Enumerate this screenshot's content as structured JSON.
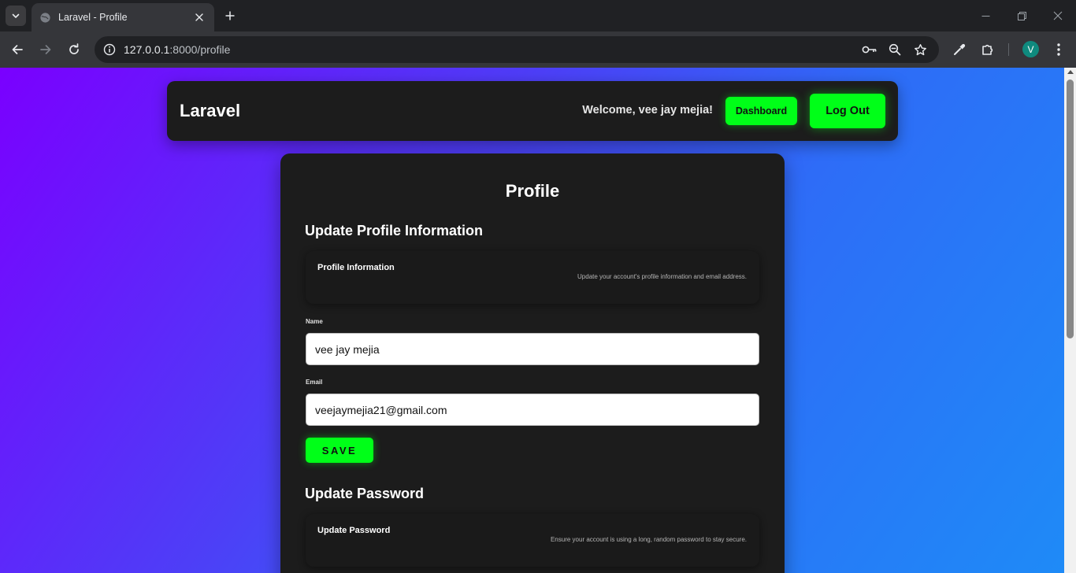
{
  "browser": {
    "tab_title": "Laravel - Profile",
    "url_host": "127.0.0.1",
    "url_path": ":8000/profile",
    "profile_initial": "V"
  },
  "nav": {
    "brand": "Laravel",
    "welcome": "Welcome, vee jay mejia!",
    "dashboard_label": "Dashboard",
    "logout_label": "Log Out"
  },
  "profile": {
    "page_title": "Profile",
    "update_info": {
      "section_title": "Update Profile Information",
      "box_title": "Profile Information",
      "box_description": "Update your account's profile information and email address.",
      "name_label": "Name",
      "name_value": "vee jay mejia",
      "email_label": "Email",
      "email_value": "veejaymejia21@gmail.com",
      "save_label": "SAVE"
    },
    "update_password": {
      "section_title": "Update Password",
      "box_title": "Update Password",
      "box_description": "Ensure your account is using a long, random password to stay secure."
    }
  },
  "colors": {
    "accent": "#00ff18",
    "card": "#1c1c1c",
    "gradient_start": "#7a00ff",
    "gradient_end": "#1e8bf7"
  }
}
